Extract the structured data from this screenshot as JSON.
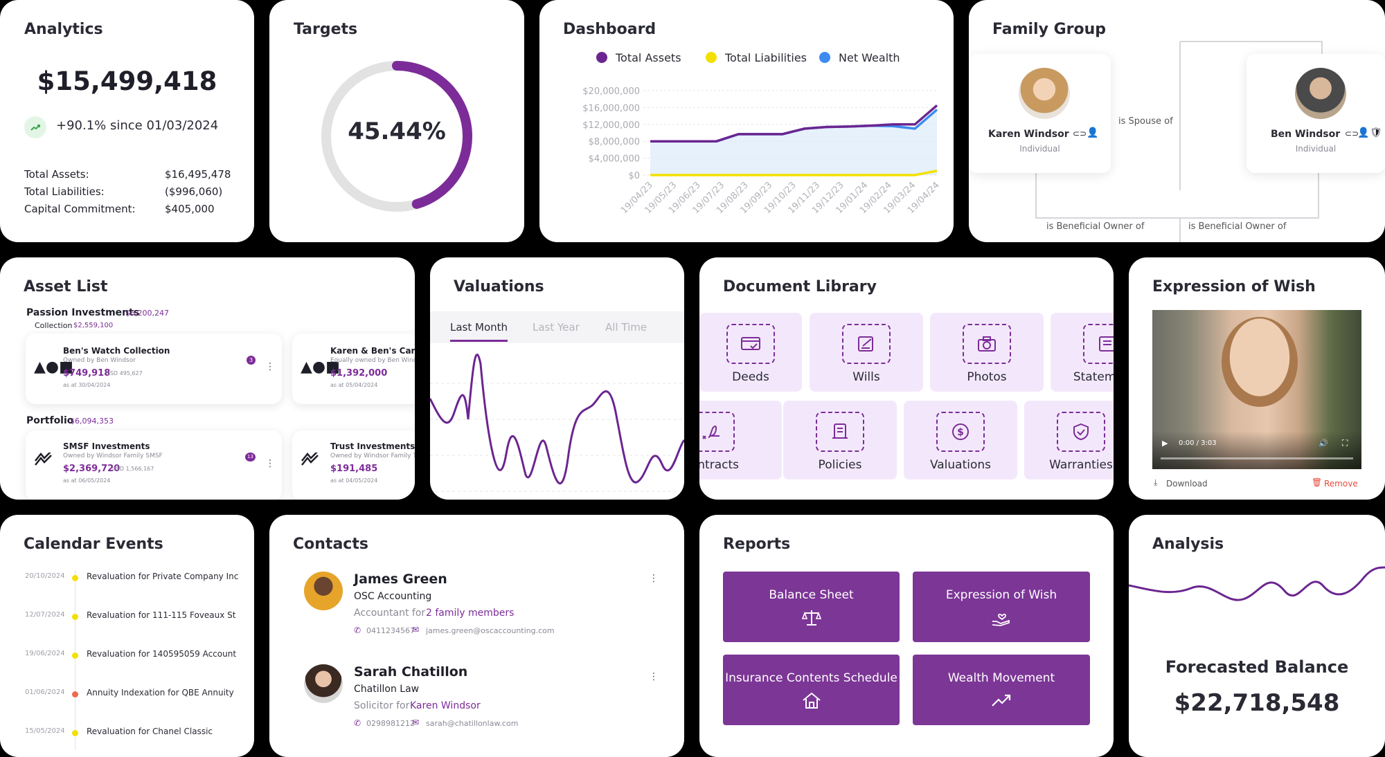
{
  "analytics": {
    "title": "Analytics",
    "total": "$15,499,418",
    "change": "+90.1% since 01/03/2024",
    "rows": [
      {
        "label": "Total Assets:",
        "value": "$16,495,478"
      },
      {
        "label": "Total Liabilities:",
        "value": "($996,060)"
      },
      {
        "label": "Capital Commitment:",
        "value": "$405,000"
      }
    ]
  },
  "targets": {
    "title": "Targets",
    "percent_label": "45.44%",
    "percent": 45.44
  },
  "dashboard": {
    "title": "Dashboard"
  },
  "chart_data": {
    "type": "line",
    "x": [
      "19/04/23",
      "19/05/23",
      "19/06/23",
      "19/07/23",
      "19/08/23",
      "19/09/23",
      "19/10/23",
      "19/11/23",
      "19/12/23",
      "19/01/24",
      "19/02/24",
      "19/03/24",
      "19/04/24"
    ],
    "y_ticks": [
      "$20,000,000",
      "$16,000,000",
      "$12,000,000",
      "$8,000,000",
      "$4,000,000",
      "$0"
    ],
    "ylim": [
      0,
      20000000
    ],
    "grid": true,
    "legend_position": "top",
    "series": [
      {
        "name": "Total Assets",
        "color": "#6b2590",
        "values": [
          8000000,
          8000000,
          8000000,
          8000000,
          9700000,
          9700000,
          9700000,
          11000000,
          11400000,
          11500000,
          11700000,
          12000000,
          12000000,
          16500000
        ]
      },
      {
        "name": "Total Liabilities",
        "color": "#f3e000",
        "values": [
          0,
          0,
          0,
          0,
          0,
          0,
          0,
          0,
          0,
          0,
          0,
          0,
          0,
          1000000
        ]
      },
      {
        "name": "Net Wealth",
        "color": "#3c8cf0",
        "values": [
          8000000,
          8000000,
          8000000,
          8000000,
          9700000,
          9700000,
          9700000,
          11000000,
          11400000,
          11500000,
          11700000,
          11600000,
          11000000,
          15500000
        ]
      }
    ]
  },
  "family": {
    "title": "Family Group",
    "members": [
      {
        "name": "Karen Windsor",
        "role": "Individual"
      },
      {
        "name": "Ben Windsor",
        "role": "Individual"
      }
    ],
    "relations": [
      "is Spouse of",
      "is Beneficial Owner of",
      "is Beneficial Owner of"
    ]
  },
  "assets": {
    "title": "Asset List",
    "groups": [
      {
        "name": "Passion Investments",
        "value": "$6,200,247",
        "sub": "Collection",
        "sub_value": "$2,559,100"
      },
      {
        "name": "Portfolio",
        "value": "$6,094,353"
      }
    ],
    "items": [
      {
        "name": "Ben's Watch Collection",
        "owner": "Owned by Ben Windsor",
        "value": "$749,918",
        "usd": "USD 495,627",
        "date": "as at 30/04/2024",
        "badge": "3"
      },
      {
        "name": "Karen & Ben's Car Collection",
        "owner": "Equally owned by Ben Windsor",
        "value": "$1,392,000",
        "date": "as at 05/04/2024"
      },
      {
        "name": "SMSF Investments",
        "owner": "Owned by Windsor Family SMSF",
        "value": "$2,369,720",
        "usd": "USD 1,566,167",
        "date": "as at 06/05/2024",
        "badge": "13"
      },
      {
        "name": "Trust Investments",
        "owner": "Owned by Windsor Family Trust",
        "value": "$191,485",
        "date": "as at 04/05/2024"
      }
    ]
  },
  "valuations": {
    "title": "Valuations",
    "tabs": [
      "Last Month",
      "Last Year",
      "All Time"
    ],
    "active_tab": "Last Month"
  },
  "doclib": {
    "title": "Document Library",
    "row1": [
      "Deeds",
      "Wills",
      "Photos",
      "Statements"
    ],
    "row2": [
      "Contracts",
      "Policies",
      "Valuations",
      "Warranties"
    ]
  },
  "wish": {
    "title": "Expression of Wish",
    "time": "0:00 / 3:03",
    "download": "Download",
    "remove": "Remove"
  },
  "calendar": {
    "title": "Calendar Events",
    "events": [
      {
        "date": "20/10/2024",
        "text": "Revaluation for Private Company Inc",
        "color": "#f3e000"
      },
      {
        "date": "12/07/2024",
        "text": "Revaluation for 111-115 Foveaux St",
        "color": "#f3e000"
      },
      {
        "date": "19/06/2024",
        "text": "Revaluation for 140595059 Account",
        "color": "#f3e000"
      },
      {
        "date": "01/06/2024",
        "text": "Annuity Indexation for QBE Annuity",
        "color": "#f06a4a"
      },
      {
        "date": "15/05/2024",
        "text": "Revaluation for Chanel Classic",
        "color": "#f3e000"
      }
    ]
  },
  "contacts": {
    "title": "Contacts",
    "people": [
      {
        "name": "James Green",
        "company": "OSC Accounting",
        "role": "Accountant for",
        "role_link": "2 family members",
        "phone": "0411234567",
        "email": "james.green@oscaccounting.com"
      },
      {
        "name": "Sarah Chatillon",
        "company": "Chatillon Law",
        "role": "Solicitor for",
        "role_link": "Karen Windsor",
        "phone": "0298981212",
        "email": "sarah@chatillonlaw.com"
      }
    ]
  },
  "reports": {
    "title": "Reports",
    "items": [
      "Balance Sheet",
      "Expression of Wish",
      "Insurance Contents Schedule",
      "Wealth Movement"
    ]
  },
  "analysis": {
    "title": "Analysis",
    "label": "Forecasted Balance",
    "value": "$22,718,548"
  }
}
